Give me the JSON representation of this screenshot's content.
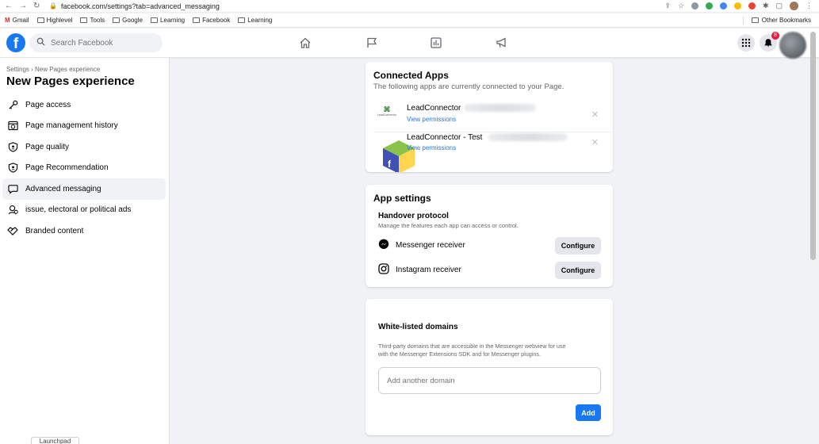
{
  "browser": {
    "url": "facebook.com/settings?tab=advanced_messaging",
    "bookmarks": [
      "Gmail",
      "Highlevel",
      "Tools",
      "Google",
      "Learning",
      "Facebook",
      "Learning"
    ],
    "other_bookmarks": "Other Bookmarks"
  },
  "topbar": {
    "logo": "f",
    "search_placeholder": "Search Facebook",
    "notification_count": "8"
  },
  "sidebar": {
    "breadcrumb": "Settings › New Pages experience",
    "title": "New Pages experience",
    "items": [
      {
        "label": "Page access",
        "icon": "key-icon"
      },
      {
        "label": "Page management history",
        "icon": "history-icon"
      },
      {
        "label": "Page quality",
        "icon": "shield-icon"
      },
      {
        "label": "Page Recommendation",
        "icon": "recommendation-icon"
      },
      {
        "label": "Advanced messaging",
        "icon": "message-icon",
        "active": true
      },
      {
        "label": "issue, electoral or political ads",
        "icon": "political-ads-icon"
      },
      {
        "label": "Branded content",
        "icon": "handshake-icon"
      }
    ],
    "launchpad": "Launchpad"
  },
  "connected_apps": {
    "title": "Connected Apps",
    "subtitle": "The following apps are currently connected to your Page.",
    "apps": [
      {
        "name": "LeadConnector",
        "link": "View permissions",
        "logo_text": "LeadConnector"
      },
      {
        "name": "LeadConnector - Test",
        "link": "View permissions"
      }
    ]
  },
  "app_settings": {
    "title": "App settings",
    "handover_title": "Handover protocol",
    "handover_desc": "Manage the features each app can access or control.",
    "receivers": [
      {
        "label": "Messenger receiver",
        "button": "Configure",
        "icon": "messenger-icon"
      },
      {
        "label": "Instagram receiver",
        "button": "Configure",
        "icon": "instagram-icon"
      }
    ]
  },
  "whitelisted": {
    "title": "White-listed domains",
    "desc_line1": "Third-party domains that are accessible in the Messenger webview for use",
    "desc_line2": "with the Messenger Extensions SDK and for Messenger plugins.",
    "input_placeholder": "Add another domain",
    "add_button": "Add"
  },
  "colors": {
    "fb_blue": "#1877f2",
    "background": "#f0f2f5",
    "notification_red": "#e41e3f"
  }
}
